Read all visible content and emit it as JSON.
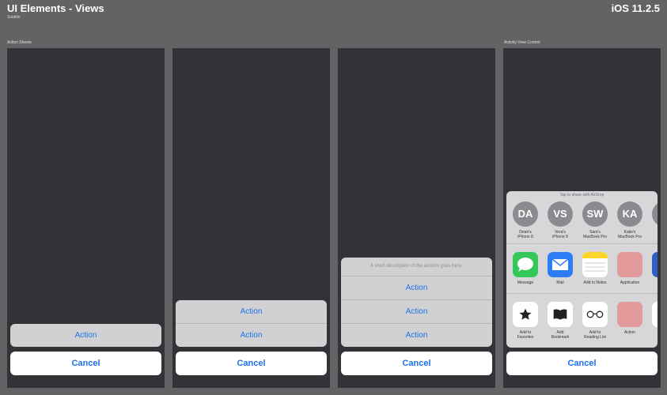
{
  "header": {
    "title": "UI Elements - Views",
    "subtitle": "Subtitle",
    "version": "iOS 11.2.5"
  },
  "sections": {
    "action_sheets": "Action Sheets",
    "activity_view": "Activity View Control"
  },
  "sheet1": {
    "actions": [
      "Action"
    ],
    "cancel": "Cancel"
  },
  "sheet2": {
    "actions": [
      "Action",
      "Action"
    ],
    "cancel": "Cancel"
  },
  "sheet3": {
    "description": "A short description of the actions goes here.",
    "actions": [
      "Action",
      "Action",
      "Action"
    ],
    "cancel": "Cancel"
  },
  "activity": {
    "airdrop_hint": "Tap to share with AirDrop",
    "people": [
      {
        "initials": "DA",
        "name_line1": "Dean's",
        "name_line2": "iPhone 8"
      },
      {
        "initials": "VS",
        "name_line1": "Vera's",
        "name_line2": "iPhone 8"
      },
      {
        "initials": "SW",
        "name_line1": "Sam's",
        "name_line2": "MacBook Pro"
      },
      {
        "initials": "KA",
        "name_line1": "Katie's",
        "name_line2": "MacBook Pro"
      }
    ],
    "apps": [
      {
        "label": "Message",
        "icon": "message-icon",
        "color": "#34c759"
      },
      {
        "label": "Mail",
        "icon": "mail-icon",
        "color": "#2f7df6"
      },
      {
        "label": "Add to Notes",
        "icon": "notes-icon",
        "color": "#ffd52e"
      },
      {
        "label": "Application",
        "icon": "application-icon",
        "color": "#e39a9a"
      }
    ],
    "actions": [
      {
        "label_line1": "Add to",
        "label_line2": "Favorites",
        "icon": "star-icon"
      },
      {
        "label_line1": "Add",
        "label_line2": "Bookmark",
        "icon": "book-icon"
      },
      {
        "label_line1": "Add to",
        "label_line2": "Reading List",
        "icon": "glasses-icon"
      },
      {
        "label_line1": "Action",
        "label_line2": "",
        "icon": "action-icon",
        "color": "#e39a9a"
      }
    ],
    "cancel": "Cancel"
  },
  "colors": {
    "accent": "#1a73e8",
    "panel": "#333337",
    "background": "#636366"
  }
}
